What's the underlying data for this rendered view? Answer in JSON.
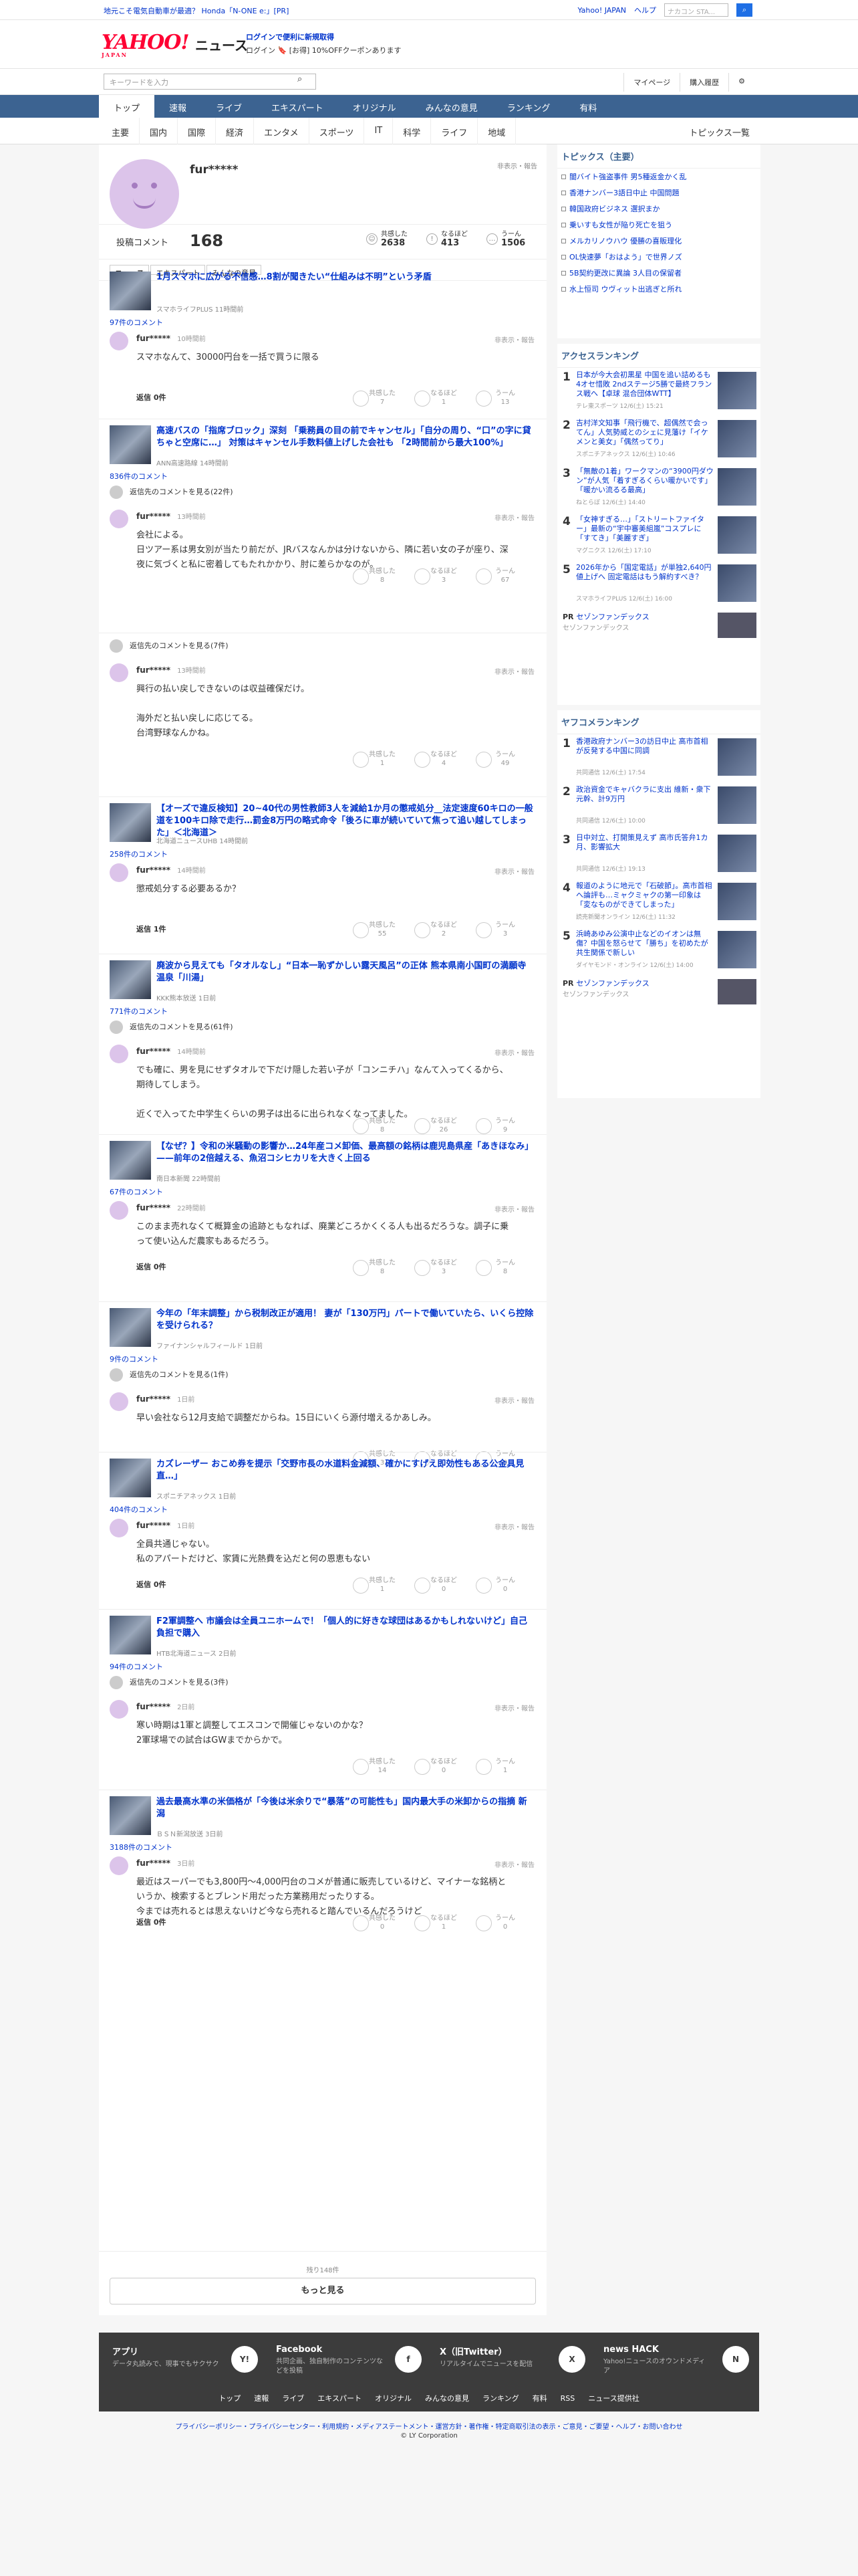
{
  "topbar": {
    "ad": "地元こそ電気自動車が最適？ Honda「N-ONE e:」[PR]",
    "links": [
      "Yahoo! JAPAN",
      "ヘルプ"
    ],
    "search_placeholder": "ウェブ検索",
    "search_query": "ナカコン STA..."
  },
  "header": {
    "logo": "YAHOO!",
    "logo_sub": "JAPAN",
    "service": "ニュース",
    "promo1": "ログインで便利に新規取得",
    "promo2": "ログイン 🔖 [お得] 10%OFFクーポンあります"
  },
  "toolbar": {
    "keyword_placeholder": "キーワードを入力",
    "mypage": "マイページ",
    "history": "購入履歴"
  },
  "gnav": [
    "トップ",
    "速報",
    "ライブ",
    "エキスパート",
    "オリジナル",
    "みんなの意見",
    "ランキング",
    "有料"
  ],
  "snav": [
    "主要",
    "国内",
    "国際",
    "経済",
    "エンタメ",
    "スポーツ",
    "IT",
    "科学",
    "ライフ",
    "地域"
  ],
  "snav_right": "トピックス一覧",
  "profile": {
    "name": "fur*****",
    "block_note": "非表示・報告",
    "comment_label": "投稿コメント",
    "comment_count": "168",
    "stats": [
      {
        "label": "共感した",
        "value": "2638"
      },
      {
        "label": "なるほど",
        "value": "413"
      },
      {
        "label": "うーん",
        "value": "1506"
      }
    ],
    "tabs": [
      "ニュース",
      "エキスパート",
      "みんなの意見"
    ]
  },
  "entries": [
    {
      "title": "1月スマホに広がる不信感…8割が聞きたい“仕組みは不明”という矛盾",
      "source": "スマホライフPLUS 11時間前",
      "count": "97件のコメント",
      "reply": "",
      "user": "fur*****",
      "time": "10時間前",
      "text": "スマホなんて、30000円台を一括で買うに限る",
      "r": "返信 0件",
      "b": [
        "共感した",
        "7",
        "なるほど",
        "1",
        "うーん",
        "13"
      ]
    },
    {
      "title": "高速バスの「指席ブロック」深刻 「乗務員の目の前でキャンセル」「自分の周り、“口”の字に貸ちゃと空席に…」 対策はキャンセル手数料値上げした会社も 「2時間前から最大100%」",
      "source": "ANN高速路線 14時間前",
      "count": "836件のコメント",
      "reply": "返信先のコメントを見る(22件)",
      "user": "fur*****",
      "time": "13時間前",
      "text": "会社による。\n日ツアー系は男女別が当たり前だが、JRバスなんかは分けないから、隣に若い女の子が座り、深夜に気づくと私に密着してもたれかかり、肘に差らかなのが。",
      "r": "",
      "b": [
        "共感した",
        "8",
        "なるほど",
        "3",
        "うーん",
        "67"
      ]
    },
    {
      "title": "",
      "source": "",
      "count": "",
      "reply": "返信先のコメントを見る(7件)",
      "user": "fur*****",
      "time": "13時間前",
      "text": "興行の払い戻しできないのは収益確保だけ。\n\n海外だと払い戻しに応じてる。\n台湾野球なんかね。",
      "r": "",
      "b": [
        "共感した",
        "1",
        "なるほど",
        "4",
        "うーん",
        "49"
      ]
    },
    {
      "title": "【オーズで違反検知】20~40代の男性教師3人を減給1か月の懲戒処分__法定速度60キロの一般道を100キロ除で走行…罰金8万円の略式命令「後ろに車が続いていて焦って追い越してしまった」＜北海道＞",
      "source": "北海道ニュースUHB 14時間前",
      "count": "258件のコメント",
      "reply": "",
      "user": "fur*****",
      "time": "14時間前",
      "text": "懲戒処分する必要あるか？",
      "r": "返信 1件",
      "b": [
        "共感した",
        "55",
        "なるほど",
        "2",
        "うーん",
        "3"
      ]
    },
    {
      "title": "廃波から見えても「タオルなし」“日本一恥ずかしい露天風呂”の正体 熊本県南小国町の満願寺温泉「川湯」",
      "source": "KKK熊本放送 1日前",
      "count": "771件のコメント",
      "reply": "返信先のコメントを見る(61件)",
      "user": "fur*****",
      "time": "14時間前",
      "text": "でも確に、男を見にせずタオルで下だけ隠した若い子が「コンニチハ」なんて入ってくるから、期待してしまう。\n\n近くで入ってた中学生くらいの男子は出るに出られなくなってました。",
      "r": "",
      "b": [
        "共感した",
        "8",
        "なるほど",
        "26",
        "うーん",
        "9"
      ]
    },
    {
      "title": "【なぜ？】令和の米騒動の影響か…24年産コメ卸価、最高額の銘柄は鹿児島県産「あきほなみ」——前年の2倍越える、魚沼コシヒカリを大きく上回る",
      "source": "南日本新聞 22時間前",
      "count": "67件のコメント",
      "reply": "",
      "user": "fur*****",
      "time": "22時間前",
      "text": "このまま売れなくて概算金の追跡ともなれば、廃業どころかくくる人も出るだろうな。調子に乗って使い込んだ農家もあるだろう。",
      "r": "返信 0件",
      "b": [
        "共感した",
        "8",
        "なるほど",
        "3",
        "うーん",
        "8"
      ]
    },
    {
      "title": "今年の「年末調整」から税制改正が適用！ 妻が「130万円」パートで働いていたら、いくら控除を受けられる？",
      "source": "ファイナンシャルフィールド 1日前",
      "count": "9件のコメント",
      "reply": "返信先のコメントを見る(1件)",
      "user": "fur*****",
      "time": "1日前",
      "text": "早い会社なら12月支給で調整だからね。15日にいくら源付増えるかあしみ。",
      "r": "",
      "b": [
        "共感した",
        "3",
        "なるほど",
        "0",
        "うーん",
        "0"
      ]
    },
    {
      "title": "カズレーザー おこめ券を提示「交野市長の水道料金減額、確かにすげえ即効性もある公金具見直…」",
      "source": "スポニチアネックス 1日前",
      "count": "404件のコメント",
      "reply": "",
      "user": "fur*****",
      "time": "1日前",
      "text": "全員共通じゃない。\n私のアパートだけど、家賃に光熱費を込だと何の恩恵もない",
      "r": "返信 0件",
      "b": [
        "共感した",
        "1",
        "なるほど",
        "0",
        "うーん",
        "0"
      ]
    },
    {
      "title": "F2軍調整へ 市議会は全員ユニホームで！「個人的に好きな球団はあるかもしれないけど」自己負担で購入",
      "source": "HTB北海道ニュース 2日前",
      "count": "94件のコメント",
      "reply": "返信先のコメントを見る(3件)",
      "user": "fur*****",
      "time": "2日前",
      "text": "寒い時期は1軍と調整してエスコンで開催じゃないのかな？\n2軍球場での試合はGWまでからかで。",
      "r": "",
      "b": [
        "共感した",
        "14",
        "なるほど",
        "0",
        "うーん",
        "1"
      ]
    },
    {
      "title": "過去最高水準の米価格が「今後は米余りで“暴落”の可能性も」国内最大手の米卸からの指摘 新潟",
      "source": "ＢＳＮ新潟放送 3日前",
      "count": "3188件のコメント",
      "reply": "",
      "user": "fur*****",
      "time": "3日前",
      "text": "最近はスーパーでも3,800円〜4,000円台のコメが普通に販売しているけど、マイナーな銘柄というか、検索するとブレンド用だった方業務用だったりする。\n今までは売れるとは思えないけど今なら売れると踏んでいるんだろうけど",
      "r": "返信 0件",
      "b": [
        "共感した",
        "0",
        "なるほど",
        "1",
        "うーん",
        "0"
      ]
    }
  ],
  "remaining": "残り148件",
  "more": "もっと見る",
  "topics": {
    "head": "トピックス（主要）",
    "items": [
      "闇バイト強盗事件 男5種返金かく乱",
      "香港ナンバー3語日中止 中国問題",
      "韓国政府ビジネス 選択まか",
      "乗いすも女性が陥り死亡を狙う",
      "メルカリノウハウ 優勝の喜販理化",
      "OL快速夢「おはよう」で世界ノズ",
      "5B契約更改に異論 3人目の保留者",
      "水上恒司 ウヴィット出逃ぎと所れ"
    ]
  },
  "access": {
    "head": "アクセスランキング",
    "items": [
      {
        "t": "日本が今大会初黒星 中国を追い詰めるも4オセ惜敗 2ndステージ5勝で最終フランス戦へ【卓球 混合団体WTT】",
        "m": "テレ東スポーツ 12/6(土) 15:21"
      },
      {
        "t": "吉村洋文知事「飛行機で、超偶然で会ってん」人気勢威とのシェに見藩け「イケメンと美女」「偶然ってり」",
        "m": "スポニチアネックス 12/6(土) 10:46"
      },
      {
        "t": "「無敵の1着」ワークマンの“3900円ダウン”が人気「着すぎるくらい暖かいです」「暖かい流るる最高」",
        "m": "ねとらぼ 12/6(土) 14:40"
      },
      {
        "t": "「女神すぎる…」「ストリートファイター」最新の“宇中審美組嵐”コスプレに「すてき」「美麗すぎ」",
        "m": "マグニクス 12/6(土) 17:10"
      },
      {
        "t": "2026年から「国定電話」が単独2,640円値上げへ 固定電話はもう解約すべき？",
        "m": "スマホライフPLUS 12/6(土) 16:00"
      }
    ]
  },
  "pr": {
    "label": "PR",
    "sponsor": "セゾンファンデックス",
    "caption": "セゾンファンデックス"
  },
  "yahooco": {
    "head": "ヤフコメランキング",
    "items": [
      {
        "t": "香港政府ナンバー3の訪日中止 高市首相が反発する中国に同調",
        "m": "共同通信 12/6(土) 17:54"
      },
      {
        "t": "政治資金でキャバクラに支出 維新・衆下元幹、計9万円",
        "m": "共同通信 12/6(土) 10:00"
      },
      {
        "t": "日中対立、打開策見えず 高市氏答弁1カ月、影響拡大",
        "m": "共同通信 12/6(土) 19:13"
      },
      {
        "t": "報道のように地元で「石破節」。高市首相へ論評も…ミャクミャクの第一印象は「変なものができてしまった」",
        "m": "読売新聞オンライン 12/6(土) 11:32"
      },
      {
        "t": "浜崎あゆみ公演中止などのイオンは無傷？中国を怒らせて「勝ち」を初めたが共生関係で新しい",
        "m": "ダイヤモンド・オンライン 12/6(土) 14:00"
      }
    ]
  },
  "footer": {
    "cols": [
      {
        "t": "アプリ",
        "d": "データ丸読みで、現事でもサクサク",
        "i": "Y!"
      },
      {
        "t": "Facebook",
        "d": "共同企画、独自制作のコンテンツなどを投稿",
        "i": "f"
      },
      {
        "t": "X（旧Twitter）",
        "d": "リアルタイムでニュースを配信",
        "i": "X"
      },
      {
        "t": "news HACK",
        "d": "Yahoo!ニュースのオウンドメディア",
        "i": "N"
      }
    ],
    "links": [
      "トップ",
      "速報",
      "ライブ",
      "エキスパート",
      "オリジナル",
      "みんなの意見",
      "ランキング",
      "有料",
      "RSS",
      "ニュース提供社"
    ],
    "legal": "プライバシーポリシー・プライバシーセンター・利用規約・メディアステートメント・運営方針・著作権・特定商取引法の表示・ご意見・ご要望・ヘルプ・お問い合わせ",
    "copy": "© LY Corporation"
  }
}
